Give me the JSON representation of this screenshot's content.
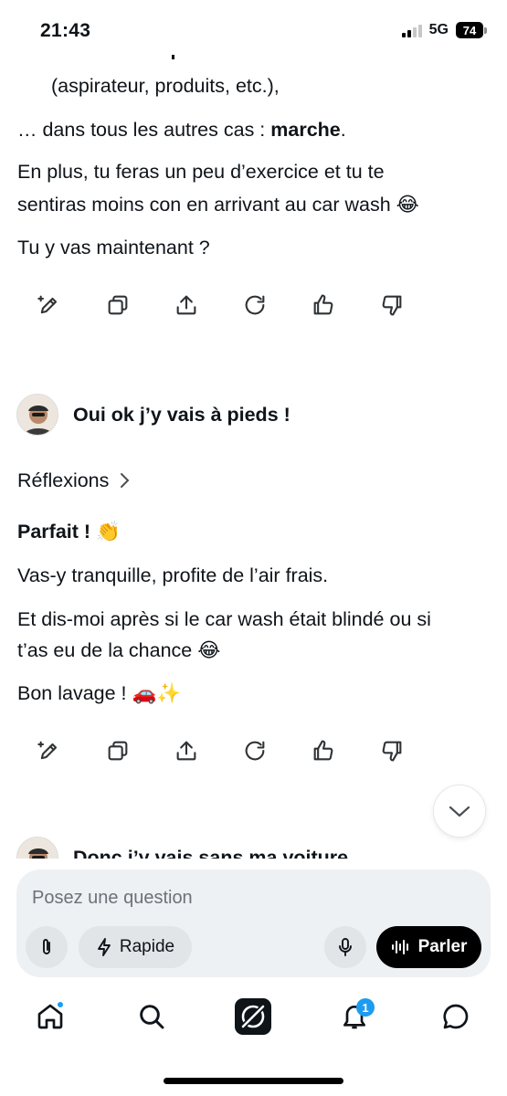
{
  "status_bar": {
    "time": "21:43",
    "network": "5G",
    "battery": "74"
  },
  "messages": {
    "reply1": {
      "line_list": "(aspirateur, produits, etc.),",
      "line_cases_prefix": "… dans tous les autres cas : ",
      "line_cases_bold": "marche",
      "line_cases_suffix": ".",
      "line_plus_1": "En plus, tu feras un peu d’exercice et tu te",
      "line_plus_2": "sentiras moins con en arrivant au car wash 😂",
      "line_question": "Tu y vas maintenant ?"
    },
    "user1": {
      "text": "Oui ok j’y vais à pieds !"
    },
    "reply2": {
      "reflexions": "Réflexions",
      "title": "Parfait ! 👏",
      "line1": "Vas-y tranquille, profite de l’air frais.",
      "line2a": "Et dis-moi après si le car wash était blindé ou si",
      "line2b": "t’as eu de la chance 😂",
      "line3": "Bon lavage ! 🚗✨"
    },
    "user2": {
      "text": "Donc j’y vais sans ma voiture"
    }
  },
  "actions": [
    "edit-icon",
    "copy-icon",
    "share-icon",
    "regenerate-icon",
    "thumbs-up-icon",
    "thumbs-down-icon"
  ],
  "composer": {
    "placeholder": "Posez une question",
    "rapide_label": "Rapide",
    "parler_label": "Parler"
  },
  "nav": {
    "notifications_badge": "1",
    "items": [
      "home-icon",
      "search-icon",
      "grok-icon",
      "notifications-icon",
      "messages-icon"
    ]
  },
  "colors": {
    "accent": "#1d9bf0",
    "text": "#0f1419",
    "composer_bg": "#eef1f3"
  }
}
